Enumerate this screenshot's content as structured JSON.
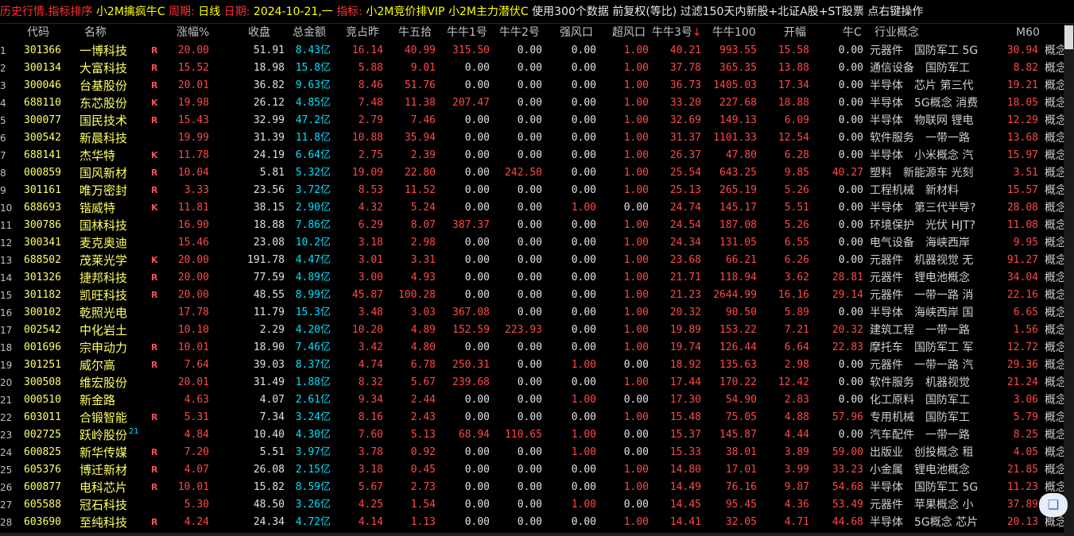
{
  "titlebar": {
    "prefix": "历史行情.指标排序",
    "strategy": "小2M擒疯牛C",
    "period_label": "周期:",
    "period": "日线",
    "date_label": "日期:",
    "date": "2024-10-21,一",
    "indicator_label": "指标:",
    "indicator": "小2M竞价排VIP 小2M主力潜伏C",
    "settings": "使用300个数据 前复权(等比) 过滤150天内新股+北证A股+ST股票 点右键操作"
  },
  "columns": [
    "代码",
    "名称",
    "涨幅%",
    "收盘",
    "总金额",
    "竞占昨",
    "牛五拾",
    "牛牛1号",
    "牛牛2号",
    "强风口",
    "超风口",
    "牛牛3号",
    "牛牛100",
    "开幅",
    "牛C",
    "行业概念",
    "M60"
  ],
  "sort_arrow": "↓",
  "rows": [
    {
      "i": "1",
      "code": "301366",
      "name": "一博科技",
      "flag": "R",
      "chg": "20.00",
      "close": "51.91",
      "amt": "8.43亿",
      "jzz": "16.14",
      "nws": "40.99",
      "nn1": "315.50",
      "nn2": "0.00",
      "qfk": "0.00",
      "cfk": "1.00",
      "nn3": "40.21",
      "nn100": "993.55",
      "kf": "15.58",
      "nc": "0.00",
      "ind": "元器件　国防军工 5G",
      "m60": "30.94",
      "extra": "概念"
    },
    {
      "i": "2",
      "code": "300134",
      "name": "大富科技",
      "flag": "R",
      "chg": "15.52",
      "close": "18.98",
      "amt": "15.8亿",
      "jzz": "5.88",
      "nws": "9.01",
      "nn1": "0.00",
      "nn2": "0.00",
      "qfk": "0.00",
      "cfk": "1.00",
      "nn3": "37.78",
      "nn100": "365.35",
      "kf": "13.88",
      "nc": "0.00",
      "ind": "通信设备　国防军工",
      "m60": "8.82",
      "extra": "概念"
    },
    {
      "i": "3",
      "code": "300046",
      "name": "台基股份",
      "flag": "R",
      "chg": "20.01",
      "close": "36.82",
      "amt": "9.63亿",
      "jzz": "8.46",
      "nws": "51.76",
      "nn1": "0.00",
      "nn2": "0.00",
      "qfk": "0.00",
      "cfk": "1.00",
      "nn3": "36.73",
      "nn100": "1405.03",
      "kf": "17.34",
      "nc": "0.00",
      "ind": "半导体　芯片 第三代",
      "m60": "19.21",
      "extra": "概念"
    },
    {
      "i": "4",
      "code": "688110",
      "name": "东芯股份",
      "flag": "K",
      "chg": "19.98",
      "close": "26.12",
      "amt": "4.85亿",
      "jzz": "7.48",
      "nws": "11.38",
      "nn1": "207.47",
      "nn2": "0.00",
      "qfk": "0.00",
      "cfk": "1.00",
      "nn3": "33.20",
      "nn100": "227.68",
      "kf": "18.88",
      "nc": "0.00",
      "ind": "半导体　5G概念 消费",
      "m60": "18.05",
      "extra": "概念"
    },
    {
      "i": "5",
      "code": "300077",
      "name": "国民技术",
      "flag": "R",
      "chg": "15.43",
      "close": "32.99",
      "amt": "47.2亿",
      "jzz": "2.79",
      "nws": "7.46",
      "nn1": "0.00",
      "nn2": "0.00",
      "qfk": "0.00",
      "cfk": "1.00",
      "nn3": "32.69",
      "nn100": "149.13",
      "kf": "6.09",
      "nc": "0.00",
      "ind": "半导体　物联网 锂电",
      "m60": "12.29",
      "extra": "概念"
    },
    {
      "i": "6",
      "code": "300542",
      "name": "新晨科技",
      "flag": "",
      "chg": "19.99",
      "close": "31.39",
      "amt": "11.8亿",
      "jzz": "10.88",
      "nws": "35.94",
      "nn1": "0.00",
      "nn2": "0.00",
      "qfk": "0.00",
      "cfk": "1.00",
      "nn3": "31.37",
      "nn100": "1101.33",
      "kf": "12.54",
      "nc": "0.00",
      "ind": "软件服务　一带一路",
      "m60": "13.68",
      "extra": "概念"
    },
    {
      "i": "7",
      "code": "688141",
      "name": "杰华特",
      "flag": "K",
      "chg": "11.78",
      "close": "24.19",
      "amt": "6.64亿",
      "jzz": "2.75",
      "nws": "2.39",
      "nn1": "0.00",
      "nn2": "0.00",
      "qfk": "0.00",
      "cfk": "1.00",
      "nn3": "26.37",
      "nn100": "47.80",
      "kf": "6.28",
      "nc": "0.00",
      "ind": "半导体　小米概念 汽",
      "m60": "15.97",
      "extra": "概念"
    },
    {
      "i": "8",
      "code": "000859",
      "name": "国风新材",
      "flag": "R",
      "chg": "10.04",
      "close": "5.81",
      "amt": "5.32亿",
      "jzz": "19.09",
      "nws": "22.80",
      "nn1": "0.00",
      "nn2": "242.50",
      "qfk": "0.00",
      "cfk": "1.00",
      "nn3": "25.54",
      "nn100": "643.25",
      "kf": "9.85",
      "nc": "40.27",
      "ind": "塑料　新能源车 光刻",
      "m60": "3.51",
      "extra": "概念"
    },
    {
      "i": "9",
      "code": "301161",
      "name": "唯万密封",
      "flag": "R",
      "chg": "3.33",
      "close": "23.56",
      "amt": "3.72亿",
      "jzz": "8.53",
      "nws": "11.52",
      "nn1": "0.00",
      "nn2": "0.00",
      "qfk": "0.00",
      "cfk": "1.00",
      "nn3": "25.13",
      "nn100": "265.19",
      "kf": "5.26",
      "nc": "0.00",
      "ind": "工程机械　新材料",
      "m60": "15.57",
      "extra": "概念"
    },
    {
      "i": "10",
      "code": "688693",
      "name": "锴威特",
      "flag": "K",
      "chg": "11.81",
      "close": "38.15",
      "amt": "2.90亿",
      "jzz": "4.32",
      "nws": "5.24",
      "nn1": "0.00",
      "nn2": "0.00",
      "qfk": "1.00",
      "cfk": "0.00",
      "nn3": "24.74",
      "nn100": "145.17",
      "kf": "5.51",
      "nc": "0.00",
      "ind": "半导体　第三代半导?",
      "m60": "28.08",
      "extra": "概念"
    },
    {
      "i": "11",
      "code": "300786",
      "name": "国林科技",
      "flag": "",
      "chg": "16.90",
      "close": "18.88",
      "amt": "7.86亿",
      "jzz": "6.29",
      "nws": "8.07",
      "nn1": "387.37",
      "nn2": "0.00",
      "qfk": "0.00",
      "cfk": "1.00",
      "nn3": "24.54",
      "nn100": "187.08",
      "kf": "5.26",
      "nc": "0.00",
      "ind": "环境保护　光伏 HJT?",
      "m60": "11.08",
      "extra": "概念"
    },
    {
      "i": "12",
      "code": "300341",
      "name": "麦克奥迪",
      "flag": "",
      "chg": "15.46",
      "close": "23.08",
      "amt": "10.2亿",
      "jzz": "3.18",
      "nws": "2.98",
      "nn1": "0.00",
      "nn2": "0.00",
      "qfk": "0.00",
      "cfk": "1.00",
      "nn3": "24.34",
      "nn100": "131.05",
      "kf": "6.55",
      "nc": "0.00",
      "ind": "电气设备　海峡西岸",
      "m60": "9.95",
      "extra": "概念"
    },
    {
      "i": "13",
      "code": "688502",
      "name": "茂莱光学",
      "flag": "K",
      "chg": "20.00",
      "close": "191.78",
      "amt": "4.47亿",
      "jzz": "3.01",
      "nws": "3.31",
      "nn1": "0.00",
      "nn2": "0.00",
      "qfk": "0.00",
      "cfk": "1.00",
      "nn3": "23.68",
      "nn100": "66.21",
      "kf": "6.26",
      "nc": "0.00",
      "ind": "元器件　机器视觉 无",
      "m60": "91.27",
      "extra": "概念"
    },
    {
      "i": "14",
      "code": "301326",
      "name": "捷邦科技",
      "flag": "R",
      "chg": "20.00",
      "close": "77.59",
      "amt": "4.89亿",
      "jzz": "3.00",
      "nws": "4.93",
      "nn1": "0.00",
      "nn2": "0.00",
      "qfk": "0.00",
      "cfk": "1.00",
      "nn3": "21.71",
      "nn100": "118.94",
      "kf": "3.62",
      "nc": "28.81",
      "ind": "元器件　锂电池概念",
      "m60": "34.04",
      "extra": "概念"
    },
    {
      "i": "15",
      "code": "301182",
      "name": "凯旺科技",
      "flag": "R",
      "chg": "20.00",
      "close": "48.55",
      "amt": "8.99亿",
      "jzz": "45.87",
      "nws": "100.28",
      "nn1": "0.00",
      "nn2": "0.00",
      "qfk": "0.00",
      "cfk": "1.00",
      "nn3": "21.23",
      "nn100": "2644.99",
      "kf": "16.16",
      "nc": "29.14",
      "ind": "元器件　一带一路 消",
      "m60": "22.16",
      "extra": "概念"
    },
    {
      "i": "16",
      "code": "300102",
      "name": "乾照光电",
      "flag": "",
      "chg": "17.78",
      "close": "11.79",
      "amt": "15.3亿",
      "jzz": "3.48",
      "nws": "3.03",
      "nn1": "367.08",
      "nn2": "0.00",
      "qfk": "0.00",
      "cfk": "1.00",
      "nn3": "20.32",
      "nn100": "90.50",
      "kf": "5.89",
      "nc": "0.00",
      "ind": "半导体　海峡西岸 国",
      "m60": "6.65",
      "extra": "概念"
    },
    {
      "i": "17",
      "code": "002542",
      "name": "中化岩土",
      "flag": "",
      "chg": "10.10",
      "close": "2.29",
      "amt": "4.20亿",
      "jzz": "10.20",
      "nws": "4.89",
      "nn1": "152.59",
      "nn2": "223.93",
      "qfk": "0.00",
      "cfk": "1.00",
      "nn3": "19.89",
      "nn100": "153.22",
      "kf": "7.21",
      "nc": "20.32",
      "ind": "建筑工程　一带一路",
      "m60": "1.56",
      "extra": "概念"
    },
    {
      "i": "18",
      "code": "001696",
      "name": "宗申动力",
      "flag": "R",
      "chg": "10.01",
      "close": "18.90",
      "amt": "7.46亿",
      "jzz": "3.42",
      "nws": "4.80",
      "nn1": "0.00",
      "nn2": "0.00",
      "qfk": "0.00",
      "cfk": "1.00",
      "nn3": "19.74",
      "nn100": "126.44",
      "kf": "6.64",
      "nc": "22.83",
      "ind": "摩托车　国防军工 军",
      "m60": "12.72",
      "extra": "概念"
    },
    {
      "i": "19",
      "code": "301251",
      "name": "威尔高",
      "flag": "R",
      "chg": "7.64",
      "close": "39.03",
      "amt": "8.37亿",
      "jzz": "4.74",
      "nws": "6.78",
      "nn1": "250.31",
      "nn2": "0.00",
      "qfk": "1.00",
      "cfk": "0.00",
      "nn3": "18.92",
      "nn100": "135.63",
      "kf": "2.98",
      "nc": "0.00",
      "ind": "元器件　一带一路 汽",
      "m60": "29.36",
      "extra": "概念"
    },
    {
      "i": "20",
      "code": "300508",
      "name": "维宏股份",
      "flag": "",
      "chg": "20.01",
      "close": "31.49",
      "amt": "1.88亿",
      "jzz": "8.32",
      "nws": "5.67",
      "nn1": "239.68",
      "nn2": "0.00",
      "qfk": "0.00",
      "cfk": "1.00",
      "nn3": "17.44",
      "nn100": "170.22",
      "kf": "12.42",
      "nc": "0.00",
      "ind": "软件服务　机器视觉",
      "m60": "21.24",
      "extra": "概念"
    },
    {
      "i": "21",
      "code": "000510",
      "name": "新金路",
      "flag": "",
      "chg": "4.63",
      "close": "4.07",
      "amt": "2.61亿",
      "jzz": "9.34",
      "nws": "2.44",
      "nn1": "0.00",
      "nn2": "0.00",
      "qfk": "1.00",
      "cfk": "0.00",
      "nn3": "17.30",
      "nn100": "54.90",
      "kf": "2.83",
      "nc": "0.00",
      "ind": "化工原料　国防军工",
      "m60": "3.06",
      "extra": "概念"
    },
    {
      "i": "22",
      "code": "603011",
      "name": "合锻智能",
      "flag": "R",
      "chg": "5.31",
      "close": "7.34",
      "amt": "3.24亿",
      "jzz": "8.16",
      "nws": "2.43",
      "nn1": "0.00",
      "nn2": "0.00",
      "qfk": "0.00",
      "cfk": "1.00",
      "nn3": "15.48",
      "nn100": "75.05",
      "kf": "4.88",
      "nc": "57.96",
      "ind": "专用机械　国防军工",
      "m60": "5.79",
      "extra": "概念"
    },
    {
      "i": "23",
      "code": "002725",
      "name": "跃岭股份",
      "sup": "21",
      "flag": "",
      "chg": "4.84",
      "close": "10.40",
      "amt": "4.30亿",
      "jzz": "7.60",
      "nws": "5.13",
      "nn1": "68.94",
      "nn2": "110.65",
      "qfk": "1.00",
      "cfk": "0.00",
      "nn3": "15.37",
      "nn100": "145.87",
      "kf": "4.44",
      "nc": "0.00",
      "ind": "汽车配件　一带一路",
      "m60": "8.25",
      "extra": "概念"
    },
    {
      "i": "24",
      "code": "600825",
      "name": "新华传媒",
      "flag": "R",
      "chg": "7.20",
      "close": "5.51",
      "amt": "3.97亿",
      "jzz": "3.78",
      "nws": "0.92",
      "nn1": "0.00",
      "nn2": "0.00",
      "qfk": "1.00",
      "cfk": "0.00",
      "nn3": "15.33",
      "nn100": "38.01",
      "kf": "3.89",
      "nc": "59.00",
      "ind": "出版业　创投概念 租",
      "m60": "4.05",
      "extra": "概念"
    },
    {
      "i": "25",
      "code": "605376",
      "name": "博迁新材",
      "flag": "R",
      "chg": "4.07",
      "close": "26.08",
      "amt": "2.15亿",
      "jzz": "3.18",
      "nws": "0.45",
      "nn1": "0.00",
      "nn2": "0.00",
      "qfk": "0.00",
      "cfk": "1.00",
      "nn3": "14.80",
      "nn100": "17.01",
      "kf": "3.99",
      "nc": "33.23",
      "ind": "小金属　锂电池概念",
      "m60": "21.85",
      "extra": "概念"
    },
    {
      "i": "26",
      "code": "600877",
      "name": "电科芯片",
      "flag": "R",
      "chg": "10.01",
      "close": "15.82",
      "amt": "8.59亿",
      "jzz": "5.67",
      "nws": "2.73",
      "nn1": "0.00",
      "nn2": "0.00",
      "qfk": "0.00",
      "cfk": "1.00",
      "nn3": "14.49",
      "nn100": "76.16",
      "kf": "9.87",
      "nc": "54.68",
      "ind": "半导体　国防军工 5G",
      "m60": "11.23",
      "extra": "概念"
    },
    {
      "i": "27",
      "code": "605588",
      "name": "冠石科技",
      "flag": "",
      "chg": "5.30",
      "close": "48.50",
      "amt": "3.26亿",
      "jzz": "4.25",
      "nws": "1.54",
      "nn1": "0.00",
      "nn2": "0.00",
      "qfk": "1.00",
      "cfk": "0.00",
      "nn3": "14.45",
      "nn100": "95.45",
      "kf": "4.36",
      "nc": "53.49",
      "ind": "元器件　苹果概念 小",
      "m60": "37.89",
      "extra": "概念"
    },
    {
      "i": "28",
      "code": "603690",
      "name": "至纯科技",
      "flag": "R",
      "chg": "4.24",
      "close": "24.34",
      "amt": "4.72亿",
      "jzz": "4.14",
      "nws": "1.13",
      "nn1": "0.00",
      "nn2": "0.00",
      "qfk": "0.00",
      "cfk": "1.00",
      "nn3": "14.41",
      "nn100": "32.05",
      "kf": "4.71",
      "nc": "44.68",
      "ind": "半导体　5G概念 芯片",
      "m60": "20.13",
      "extra": "概念"
    }
  ],
  "colors": {
    "up": "#ff4848",
    "neutral": "#e0e0e0",
    "amount": "#00e0ff",
    "name": "#ffff66",
    "background": "#000000"
  },
  "icons": {
    "float_button": "chat-bubble-icon"
  }
}
